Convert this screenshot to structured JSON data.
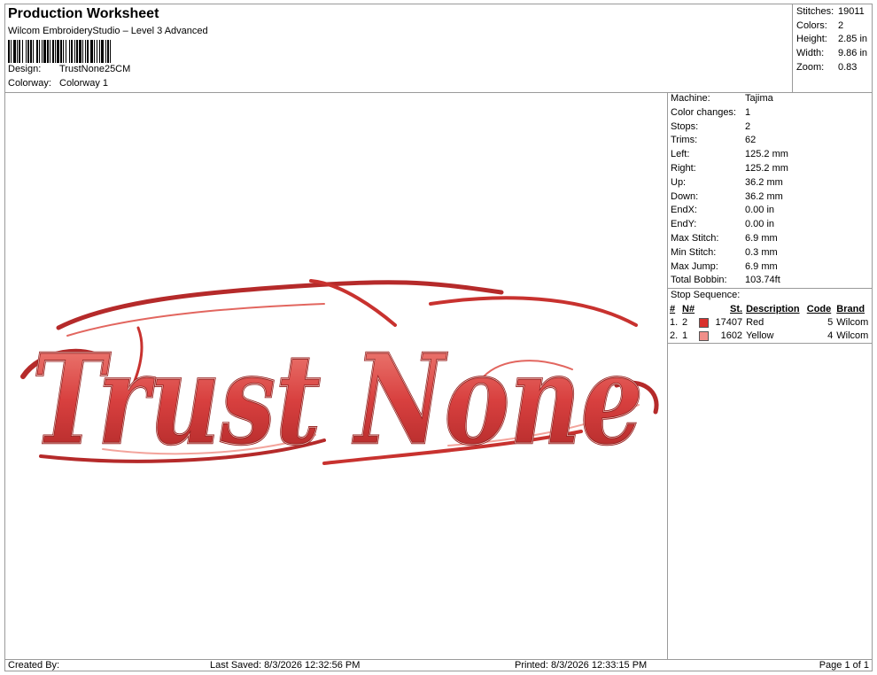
{
  "header": {
    "title": "Production Worksheet",
    "subtitle": "Wilcom EmbroideryStudio – Level 3 Advanced",
    "design_label": "Design:",
    "design_value": "TrustNone25CM",
    "colorway_label": "Colorway:",
    "colorway_value": "Colorway 1"
  },
  "summary": [
    {
      "label": "Stitches:",
      "value": "19011"
    },
    {
      "label": "Colors:",
      "value": "2"
    },
    {
      "label": "Height:",
      "value": "2.85 in"
    },
    {
      "label": "Width:",
      "value": "9.86 in"
    },
    {
      "label": "Zoom:",
      "value": "0.83"
    }
  ],
  "design": {
    "text": "Trust None",
    "colors": {
      "thread": "#d8403f",
      "shadow": "#9b1c1c",
      "highlight": "#f4a49c"
    }
  },
  "machine_info": [
    {
      "label": "Machine:",
      "value": "Tajima"
    },
    {
      "label": "Color changes:",
      "value": "1"
    },
    {
      "label": "Stops:",
      "value": "2"
    },
    {
      "label": "Trims:",
      "value": "62"
    },
    {
      "label": "Left:",
      "value": "125.2 mm"
    },
    {
      "label": "Right:",
      "value": "125.2 mm"
    },
    {
      "label": "Up:",
      "value": "36.2 mm"
    },
    {
      "label": "Down:",
      "value": "36.2 mm"
    },
    {
      "label": "EndX:",
      "value": "0.00 in"
    },
    {
      "label": "EndY:",
      "value": "0.00 in"
    },
    {
      "label": "Max Stitch:",
      "value": "6.9 mm"
    },
    {
      "label": "Min Stitch:",
      "value": "0.3 mm"
    },
    {
      "label": "Max Jump:",
      "value": "6.9 mm"
    },
    {
      "label": "Total Bobbin:",
      "value": "103.74ft"
    }
  ],
  "stop_sequence": {
    "title": "Stop Sequence:",
    "headers": {
      "index": "#",
      "needle": "N#",
      "stitches": "St.",
      "description": "Description",
      "code": "Code",
      "brand": "Brand"
    },
    "rows": [
      {
        "index": "1.",
        "needle": "2",
        "swatch": "#d9302c",
        "stitches": "17407",
        "description": "Red",
        "code": "5",
        "brand": "Wilcom"
      },
      {
        "index": "2.",
        "needle": "1",
        "swatch": "#f08f8a",
        "stitches": "1602",
        "description": "Yellow",
        "code": "4",
        "brand": "Wilcom"
      }
    ]
  },
  "footer": {
    "created_by": "Created By:",
    "last_saved": "Last Saved: 8/3/2026 12:32:56 PM",
    "printed": "Printed: 8/3/2026 12:33:15 PM",
    "page": "Page 1 of 1"
  }
}
